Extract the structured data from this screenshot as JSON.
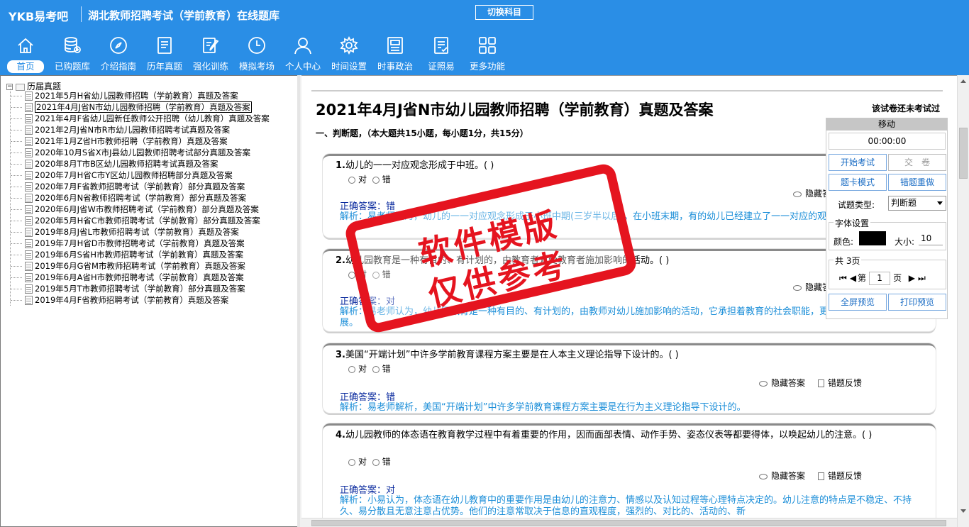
{
  "header": {
    "logo": "YKB易考吧",
    "title": "湖北教师招聘考试（学前教育）在线题库",
    "switch_label": "切换科目"
  },
  "nav": [
    {
      "label": "首页",
      "icon": "home-icon"
    },
    {
      "label": "已购题库",
      "icon": "database-icon"
    },
    {
      "label": "介绍指南",
      "icon": "compass-icon"
    },
    {
      "label": "历年真题",
      "icon": "document-list-icon"
    },
    {
      "label": "强化训练",
      "icon": "edit-icon"
    },
    {
      "label": "模拟考场",
      "icon": "clock-icon"
    },
    {
      "label": "个人中心",
      "icon": "user-icon"
    },
    {
      "label": "时间设置",
      "icon": "gear-icon"
    },
    {
      "label": "时事政治",
      "icon": "newspaper-icon"
    },
    {
      "label": "证照易",
      "icon": "checklist-icon"
    },
    {
      "label": "更多功能",
      "icon": "grid-icon"
    }
  ],
  "tree": {
    "root": "历届真题",
    "items": [
      "2021年5月H省幼儿园教师招聘（学前教育）真题及答案",
      "2021年4月J省N市幼儿园教师招聘（学前教育）真题及答案",
      "2021年4月F省幼儿园新任教师公开招聘（幼儿教育）真题及答案",
      "2021年2月J省N市R市幼儿园教师招聘考试真题及答案",
      "2021年1月Z省H市教师招聘（学前教育）真题及答案",
      "2020年10月S省X市J县幼儿园教师招聘考试部分真题及答案",
      "2020年8月T市B区幼儿园教师招聘考试真题及答案",
      "2020年7月H省C市Y区幼儿园教师招聘部分真题及答案",
      "2020年7月F省教师招聘考试（学前教育）部分真题及答案",
      "2020年6月N省教师招聘考试（学前教育）部分真题及答案",
      "2020年6月J省W市教师招聘考试（学前教育）部分真题及答案",
      "2020年5月H省C市教师招聘考试（学前教育）部分真题及答案",
      "2019年8月J省L市教师招聘考试（学前教育）真题及答案",
      "2019年7月H省D市教师招聘考试（学前教育）真题及答案",
      "2019年6月S省H市教师招聘考试（学前教育）真题及答案",
      "2019年6月G省M市教师招聘考试（学前教育）真题及答案",
      "2019年6月A省H市教师招聘考试（学前教育）真题及答案",
      "2019年5月T市教师招聘考试（学前教育）部分真题及答案",
      "2019年4月F省教师招聘考试（学前教育）真题及答案"
    ]
  },
  "main": {
    "title": "2021年4月J省N市幼儿园教师招聘（学前教育）真题及答案",
    "status": "该试卷还未考试过",
    "section": "一、判断题，（本大题共15小题，每小题1分，共15分）",
    "option_true": "对",
    "option_false": "错",
    "hide_answer": "隐藏答案",
    "feedback": "错题反馈",
    "questions": [
      {
        "num": "1.",
        "text": "幼儿的一一对应观念形成于中班。( )",
        "answer": "正确答案：错",
        "expl": "解析：易老师认为，幼儿的一一对应观念形成于小班中期(三岁半以后)。在小班末期，有的幼儿已经建立了一一对应的观念"
      },
      {
        "num": "2.",
        "text": "幼儿园教育是一种有目的、有计划的，由教育者对受教育者施加影响的活动。( )",
        "answer": "正确答案：对",
        "expl": "解析：易老师认为，幼儿园教育是一种有目的、有计划的，由教师对幼儿施加影响的活动，它承担着教育的社会职能，更多强调的是幼儿的发展。"
      },
      {
        "num": "3.",
        "text": "美国“开端计划”中许多学前教育课程方案主要是在人本主义理论指导下设计的。( )",
        "answer": "正确答案：错",
        "expl": "解析：易老师解析，美国“开端计划”中许多学前教育课程方案主要是在行为主义理论指导下设计的。"
      },
      {
        "num": "4.",
        "text": "幼儿园教师的体态语在教育教学过程中有着重要的作用，因而面部表情、动作手势、姿态仪表等都要得体，以唤起幼儿的注意。( )",
        "answer": "正确答案：对",
        "expl": "解析：小易认为，体态语在幼儿教育中的重要作用是由幼儿的注意力、情感以及认知过程等心理特点决定的。幼儿注意的特点是不稳定、不持久、易分散且无意注意占优势。他们的注意常取决于信息的直观程度，强烈的、对比的、活动的、新"
      }
    ]
  },
  "control": {
    "move": "移动",
    "timer": "00:00:00",
    "start": "开始考试",
    "submit": "交　卷",
    "card_mode": "题卡模式",
    "redo_wrong": "错题重做",
    "type_label": "试题类型:",
    "type_value": "判断题",
    "font_group": "字体设置",
    "color_label": "颜色:",
    "color_value": "#000000",
    "size_label": "大小:",
    "size_value": "10",
    "pages_label": "共 3页",
    "page_prefix": "第",
    "page_value": "1",
    "page_suffix": "页",
    "full_preview": "全屏预览",
    "print_preview": "打印预览"
  },
  "watermark": {
    "line1": "软件模版",
    "line2": "仅供参考"
  },
  "colors": {
    "header_bg": "#2a8ee6",
    "answer": "#0a2a9e",
    "explanation": "#1b8ed8",
    "watermark": "#e5141f"
  }
}
